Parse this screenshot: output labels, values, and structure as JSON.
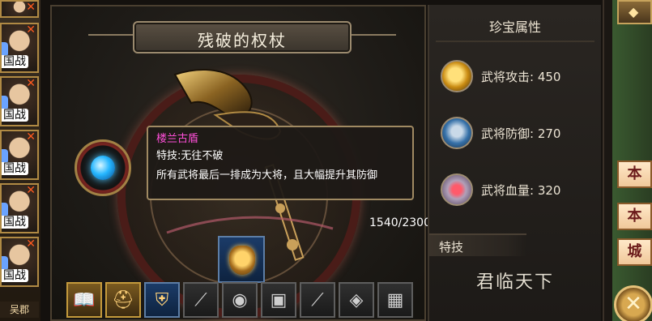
{
  "left_strip": {
    "heroes": [
      {
        "tag": "国战"
      },
      {
        "tag": "国战"
      },
      {
        "tag": "国战"
      },
      {
        "tag": "国战"
      },
      {
        "tag": "国战"
      }
    ],
    "bottom_label": "吴郡"
  },
  "main": {
    "title": "残破的权杖",
    "tooltip": {
      "name": "楼兰古盾",
      "skill_line": "特技:无往不破",
      "description": "所有武将最后一排成为大将，且大幅提升其防御"
    },
    "progress": {
      "text": "1540/2300",
      "current": 1540,
      "max": 2300
    }
  },
  "item_bar": {
    "slots": [
      {
        "icon": "book-icon",
        "glyph": "📖"
      },
      {
        "icon": "helmet-icon",
        "glyph": "⛑"
      },
      {
        "icon": "shield-icon",
        "glyph": "⛨"
      },
      {
        "icon": "blade-icon",
        "glyph": "⟋"
      },
      {
        "icon": "orb-icon",
        "glyph": "◉"
      },
      {
        "icon": "armor-icon",
        "glyph": "▣"
      },
      {
        "icon": "spear-icon",
        "glyph": "⟋"
      },
      {
        "icon": "helm-icon",
        "glyph": "◈"
      },
      {
        "icon": "chest-icon",
        "glyph": "▦"
      }
    ]
  },
  "right_panel": {
    "title": "珍宝属性",
    "stats": [
      {
        "label": "武将攻击:",
        "value": "450",
        "icon": "attack-icon"
      },
      {
        "label": "武将防御:",
        "value": "270",
        "icon": "defense-icon"
      },
      {
        "label": "武将血量:",
        "value": "320",
        "icon": "health-icon"
      }
    ],
    "skill_header": "特技",
    "skill_name": "君临天下"
  },
  "far_right": {
    "buttons": [
      "本",
      "本",
      "城"
    ],
    "close_glyph": "✕"
  },
  "colors": {
    "tooltip_title": "#ff4fd8",
    "panel_bg": "#1f1c18",
    "accent_gold": "#c49a3c"
  }
}
